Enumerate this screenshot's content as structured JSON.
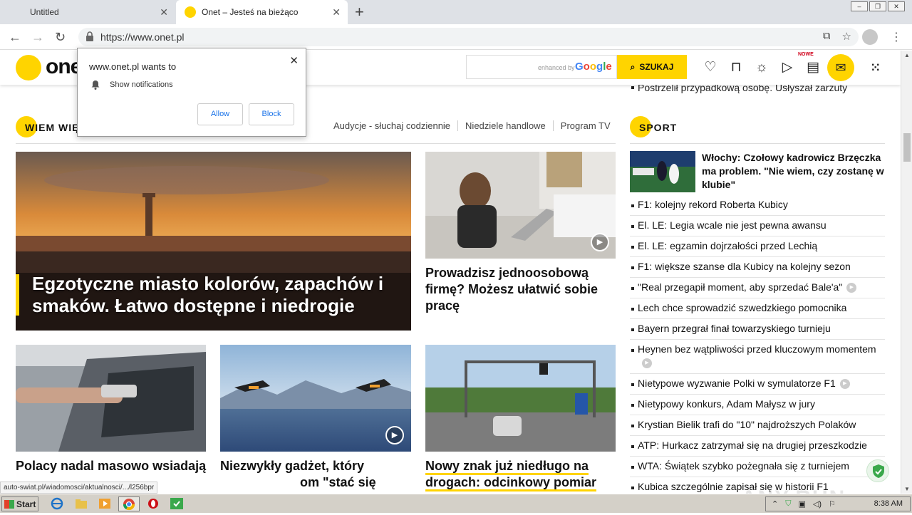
{
  "browser": {
    "tabs": [
      {
        "label": "Untitled",
        "active": false
      },
      {
        "label": "Onet – Jesteś na bieżąco",
        "active": true
      }
    ],
    "url": "https://www.onet.pl",
    "status_url": "auto-swiat.pl/wiadomosci/aktualnosci/.../l256bpr"
  },
  "notification": {
    "title": "www.onet.pl wants to",
    "message": "Show notifications",
    "allow": "Allow",
    "block": "Block"
  },
  "header": {
    "logo": "onet",
    "search_hint": "enhanced by",
    "google": "Google",
    "search_button": "SZUKAJ",
    "nowe_badge": "NOWE"
  },
  "main": {
    "section_title": "WIEM WIĘ",
    "section_links": [
      "Audycje - słuchaj codziennie",
      "Niedziele handlowe",
      "Program TV"
    ],
    "big_story": "Egzotyczne miasto kolorów, zapachów i smaków. Łatwo dostępne i niedrogie",
    "story_right": "Prowadzisz jednoosobową firmę? Możesz ułatwić sobie pracę",
    "story_1": "Polacy nadal masowo wsiadają",
    "story_2": "Niezwykły gadżet, który",
    "story_2b": "om \"stać się",
    "story_3a": "Nowy znak już niedługo na",
    "story_3b": "drogach: odcinkowy pomiar"
  },
  "sport": {
    "top_line": "Postrzelił przypadkową osobę. Usłyszał zarzuty",
    "title": "SPORT",
    "feature": "Włochy: Czołowy kadrowicz Brzęczka ma problem. \"Nie wiem, czy zostanę w klubie\"",
    "items": [
      {
        "text": "F1: kolejny rekord Roberta Kubicy",
        "video": false
      },
      {
        "text": "El. LE: Legia wcale nie jest pewna awansu",
        "video": false
      },
      {
        "text": "El. LE: egzamin dojrzałości przed Lechią",
        "video": false
      },
      {
        "text": "F1: większe szanse dla Kubicy na kolejny sezon",
        "video": false
      },
      {
        "text": "\"Real przegapił moment, aby sprzedać Bale'a\"",
        "video": true
      },
      {
        "text": "Lech chce sprowadzić szwedzkiego pomocnika",
        "video": false
      },
      {
        "text": "Bayern przegrał finał towarzyskiego turnieju",
        "video": false
      },
      {
        "text": "Heynen bez wątpliwości przed kluczowym momentem",
        "video": true
      },
      {
        "text": "Nietypowe wyzwanie Polki w symulatorze F1",
        "video": true
      },
      {
        "text": "Nietypowy konkurs, Adam Małysz w jury",
        "video": false
      },
      {
        "text": "Krystian Bielik trafi do \"10\" najdroższych Polaków",
        "video": false
      },
      {
        "text": "ATP: Hurkacz zatrzymał się na drugiej przeszkodzie",
        "video": false
      },
      {
        "text": "WTA: Świątek szybko pożegnała się z turniejem",
        "video": false
      },
      {
        "text": "Kubica szczególnie zapisał się w historii F1",
        "video": false
      }
    ]
  },
  "taskbar": {
    "start": "Start",
    "time": "8:38 AM"
  },
  "watermark": "ANY.RUN",
  "colors": {
    "brand_yellow": "#ffd400",
    "link_blue": "#1a73e8"
  }
}
